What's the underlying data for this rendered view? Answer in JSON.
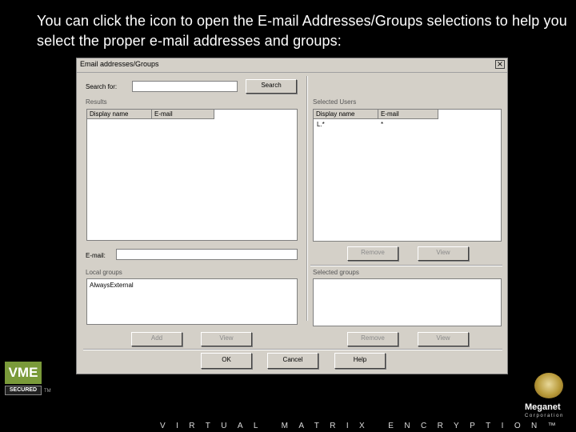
{
  "slide": {
    "caption": "You can click the  icon to open the E-mail Addresses/Groups selections to help you select the proper e-mail addresses and groups:"
  },
  "dialog": {
    "title": "Email addresses/Groups",
    "close_glyph": "×",
    "search_label": "Search for:",
    "search_value": "",
    "search_button": "Search",
    "results_label": "Results",
    "results_columns": [
      "Display name",
      "E-mail"
    ],
    "selected_users_label": "Selected Users",
    "selected_users_columns": [
      "Display name",
      "E-mail"
    ],
    "selected_users_rows": [
      {
        "display": "L.*",
        "email": "*"
      }
    ],
    "remove_button_users": "Remove",
    "view_button_users": "View",
    "email_label": "E-mail:",
    "email_value": "",
    "local_groups_label": "Local groups",
    "local_groups_items": [
      "AlwaysExternal"
    ],
    "selected_groups_label": "Selected groups",
    "add_button": "Add",
    "view_button_groups_left": "View",
    "remove_button_groups": "Remove",
    "view_button_groups_right": "View",
    "ok_button": "OK",
    "cancel_button": "Cancel",
    "help_button": "Help"
  },
  "branding": {
    "vme_logo": "VME",
    "vme_secured": "SECURED",
    "trademark": "TM",
    "footer": "VIRTUAL MATRIX ENCRYPTION™",
    "company": "Meganet",
    "company_sub": "Corporation"
  },
  "colors": {
    "background": "#000000",
    "dialog_face": "#d4d0c8",
    "vme_green": "#7a9a3a"
  }
}
